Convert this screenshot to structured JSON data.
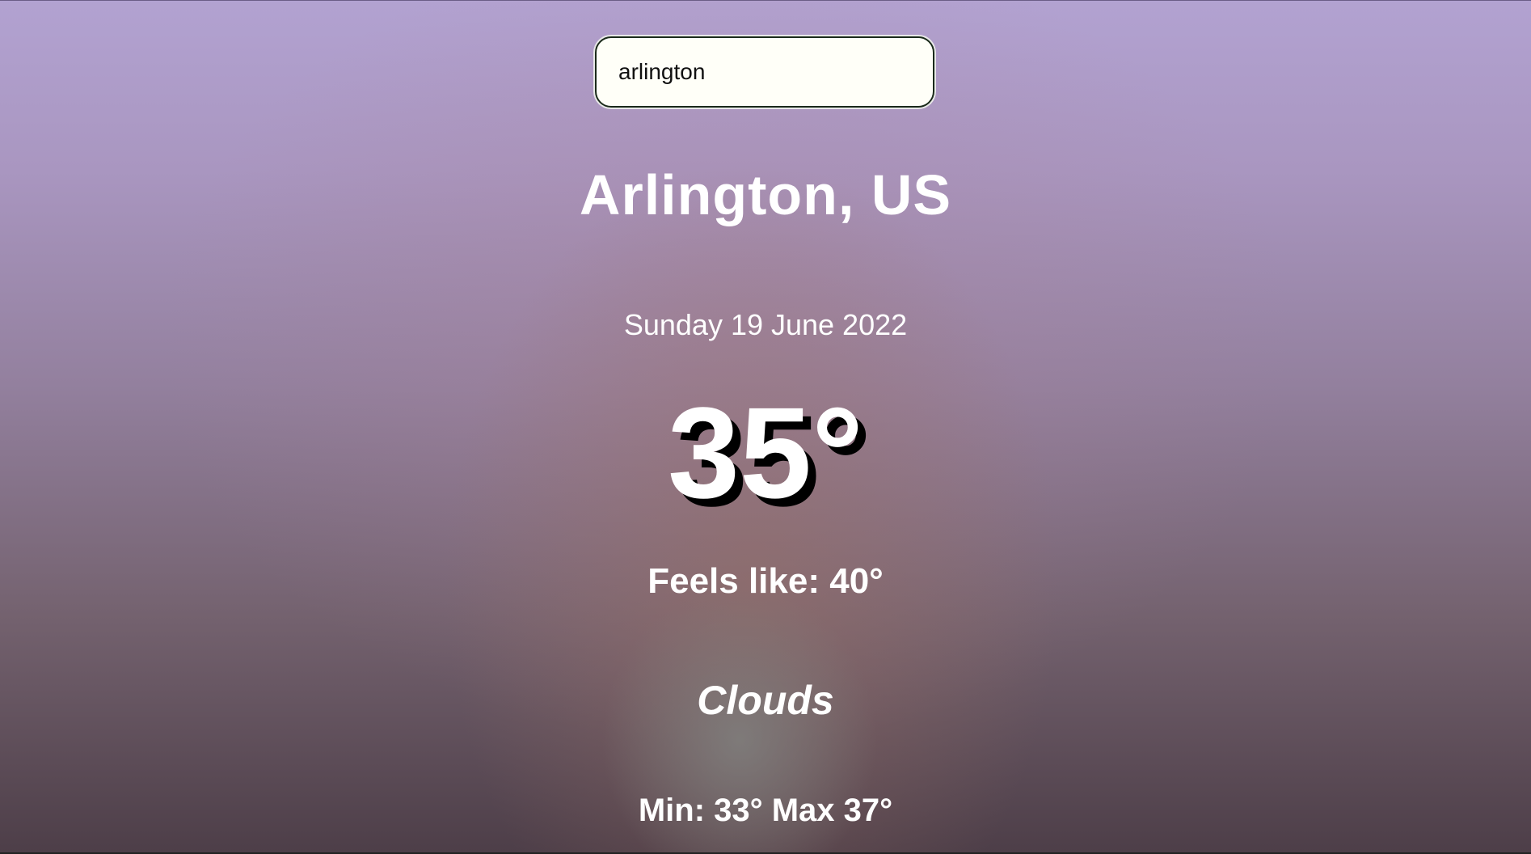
{
  "search": {
    "value": "arlington",
    "placeholder": ""
  },
  "weather": {
    "location": "Arlington, US",
    "date": "Sunday 19 June 2022",
    "temperature": "35°",
    "feels_like": "Feels like: 40°",
    "description": "Clouds",
    "min_max": "Min: 33° Max 37°"
  },
  "colors": {
    "text": "#ffffff",
    "bg_top": "#b2a2d1",
    "bg_bottom": "#4d3e48"
  }
}
